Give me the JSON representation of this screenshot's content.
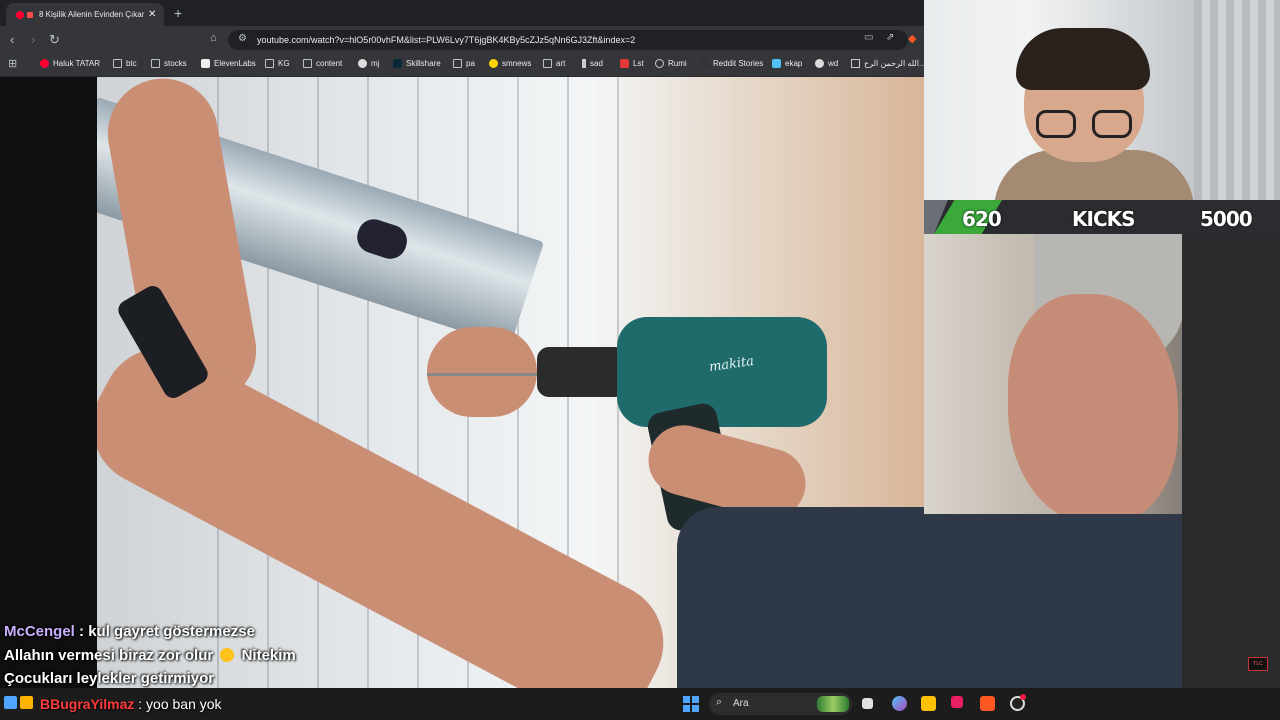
{
  "browser": {
    "tab_title": "8 Kişilik Ailenin Evinden Çıkan",
    "url": "youtube.com/watch?v=hlO5r00vhFM&list=PLW6Lvy7T6jgBK4KBy5cZJz5qNn6GJ3Zft&index=2",
    "bookmarks": [
      "Haluk TATAR",
      "btc",
      "stocks",
      "ElevenLabs",
      "KG",
      "content",
      "mj",
      "Skillshare",
      "pa",
      "smnews",
      "art",
      "sad",
      "Lst",
      "Rumi",
      "Reddit Stories",
      "ekap",
      "wd",
      "الله الرحمن الرح..."
    ]
  },
  "video": {
    "drill_brand": "makita",
    "corner_badge": "TLC"
  },
  "overlay": {
    "scores": {
      "left": "620",
      "middle": "KICKS",
      "right": "5000"
    }
  },
  "chat": {
    "messages": [
      {
        "user": "McCengel",
        "text": " : kul gayret göstermezse"
      },
      {
        "user": "",
        "text": "Allahın vermesi biraz zor olur"
      },
      {
        "user": "",
        "text": "Nitekim"
      },
      {
        "user": "",
        "text": "Çocukları leylekler getirmiyor"
      }
    ],
    "bottom": {
      "user": "BBugraYilmaz",
      "text": " : yoo ban yok"
    }
  },
  "taskbar": {
    "search_label": "Ara"
  },
  "colors": {
    "accent_green": "#3aa83a",
    "chat_user": "#c9b0ff",
    "chat_user2": "#ff3a3a"
  }
}
